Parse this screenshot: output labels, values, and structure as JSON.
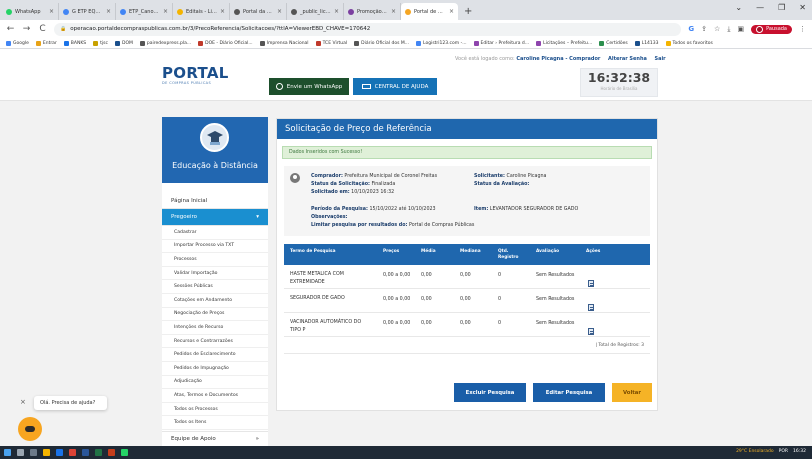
{
  "browser": {
    "tabs": [
      {
        "title": "WhatsApp",
        "color": "#25d366",
        "active": false
      },
      {
        "title": "G ETP EQUIPAMENTOS VET",
        "color": "#4285f4",
        "active": false
      },
      {
        "title": "ETP_Canoa_Avaliador_C",
        "color": "#4285f4",
        "active": false
      },
      {
        "title": "Editais - Licitações, Cont",
        "color": "#f4b400",
        "active": false
      },
      {
        "title": "Portal da Transparência",
        "color": "#555555",
        "active": false
      },
      {
        "title": "_public_licitacao_edital_C",
        "color": "#555555",
        "active": false
      },
      {
        "title": "Promoção acabad em Inr",
        "color": "#7b3fa0",
        "active": false
      },
      {
        "title": "Portal de Compras Públic",
        "color": "#f5a623",
        "active": true
      }
    ],
    "new_tab": "+",
    "url": "operacao.portaldecompraspublicas.com.br/3/PrecoReferencia/Solicitacoes/?ttlA=ViewerEBD_CHAVE=170642",
    "profile_label": "Pausada",
    "window_controls": [
      "⌄",
      "—",
      "❐",
      "✕"
    ],
    "bookmarks": [
      {
        "label": "Google",
        "color": "#4285f4"
      },
      {
        "label": "Entrar",
        "color": "#e8a317"
      },
      {
        "label": "BANKS",
        "color": "#1a73e8"
      },
      {
        "label": "tjsc",
        "color": "#c8a100"
      },
      {
        "label": "DOM",
        "color": "#1a4f8c"
      },
      {
        "label": "pairedexpress.pla...",
        "color": "#555555"
      },
      {
        "label": "DOE - Diário Oficial...",
        "color": "#c0392b"
      },
      {
        "label": "Imprensa Nacional",
        "color": "#555555"
      },
      {
        "label": "TCE Virtual",
        "color": "#c0392b"
      },
      {
        "label": "Diário Oficial dos M...",
        "color": "#555555"
      },
      {
        "label": "Logistri123.com -...",
        "color": "#4285f4"
      },
      {
        "label": "Editar › Prefeitura d...",
        "color": "#8e44ad"
      },
      {
        "label": "Licitações – Prefeitu...",
        "color": "#8e44ad"
      },
      {
        "label": "Certidões",
        "color": "#2c8f4e"
      },
      {
        "label": "L14133",
        "color": "#1a4f8c"
      },
      {
        "label": "Todos os favoritos",
        "color": "#f4b400"
      }
    ]
  },
  "header": {
    "logo": "PORTAL",
    "logo_sub": "DE COMPRAS PÚBLICAS",
    "whatsapp_button": "Envie um WhatsApp",
    "help_button": "CENTRAL DE AJUDA",
    "user_prefix": "Você está logado como:",
    "user_name": "Caroline Picagna - Comprador",
    "alter_password": "Alterar Senha",
    "logout": "Sair",
    "clock_time": "16:32:38",
    "clock_sub": "Horário de Brasília"
  },
  "sidebar": {
    "title": "Educação à Distância",
    "home": "Página Inicial",
    "section": "Pregoeiro",
    "section_arrow": "▾",
    "items": [
      "Cadastrar",
      "Importar Processo via TXT",
      "Processos",
      "Validar Importação",
      "Sessões Públicas",
      "Cotações em Andamento",
      "Negociação de Preços",
      "Intenções de Recurso",
      "Recursos e Contrarrazões",
      "Pedidos de Esclarecimento",
      "Pedidos de Impugnação",
      "Adjudicação",
      "Atas, Termos e Documentos",
      "Todos os Processos",
      "Todos os Itens",
      "Todo o Portal"
    ],
    "team": "Equipe de Apoio",
    "team_arrow": "»"
  },
  "main": {
    "title": "Solicitação de Preço de Referência",
    "alert": "Dados Inseridos com Sucesso!",
    "info": {
      "comprador_label": "Comprador:",
      "comprador_value": "Prefeitura Municipal de Coronel Freitas",
      "solicitante_label": "Solicitante:",
      "solicitante_value": "Caroline Picagna",
      "status_sol_label": "Status da Solicitação:",
      "status_sol_value": "Finalizada",
      "status_aval_label": "Status da Avaliação:",
      "status_aval_value": "",
      "solicitado_label": "Solicitado em:",
      "solicitado_value": "10/10/2023 16:32",
      "periodo_label": "Período da Pesquisa:",
      "periodo_value": "15/10/2022 até 10/10/2023",
      "item_label": "Item:",
      "item_value": "LEVANTADOR SEGURADOR DE GADO",
      "obs_label": "Observações:",
      "obs_value": "",
      "limitar_label": "Limitar pesquisa por resultados do:",
      "limitar_value": "Portal de Compras Públicas"
    },
    "table": {
      "headers": [
        "Termo de Pesquisa",
        "Preços",
        "Média",
        "Mediana",
        "Qtd. Registro",
        "Avaliação",
        "Ações"
      ],
      "rows": [
        [
          "HASTE METALICA COM EXTREMIDADE",
          "0,00 a 0,00",
          "0,00",
          "0,00",
          "0",
          "Sem Resultados"
        ],
        [
          "SEGURADOR DE GADO",
          "0,00 a 0,00",
          "0,00",
          "0,00",
          "0",
          "Sem Resultados"
        ],
        [
          "VACINADOR AUTOMÁTICO DO TIPO P",
          "0,00 a 0,00",
          "0,00",
          "0,00",
          "0",
          "Sem Resultados"
        ]
      ],
      "total": "| Total de Registros: 3"
    },
    "buttons": {
      "delete": "Excluir Pesquisa",
      "edit": "Editar Pesquisa",
      "back": "Voltar"
    }
  },
  "chat": {
    "message": "Olá. Precisa de ajuda?",
    "close": "×"
  },
  "taskbar": {
    "weather": "29°C Ensolarado",
    "lang": "POR",
    "time": "16:32"
  }
}
